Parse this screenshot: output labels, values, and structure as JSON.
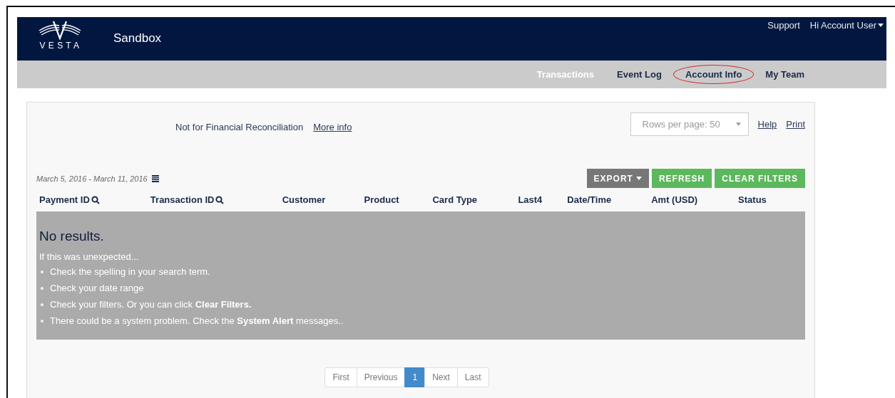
{
  "header": {
    "logo_text": "V E S T A",
    "title": "Sandbox",
    "links": [
      {
        "label": "Support",
        "kind": "link"
      },
      {
        "label": "Hi Account User",
        "kind": "dropdown"
      }
    ]
  },
  "nav": [
    {
      "label": "Transactions",
      "selected": true,
      "highlighted": false
    },
    {
      "label": "Event Log",
      "selected": false,
      "highlighted": false
    },
    {
      "label": "Account Info",
      "selected": false,
      "highlighted": true
    },
    {
      "label": "My Team",
      "selected": false,
      "highlighted": false
    }
  ],
  "notice": {
    "text": "Not for Financial Reconciliation",
    "link": "More info"
  },
  "rows_per_page": {
    "value": "Rows per page: 50"
  },
  "top_links": [
    "Help",
    "Print"
  ],
  "date_range": "March 5, 2016 - March 11, 2016",
  "actions": [
    {
      "label": "EXPORT",
      "kind": "dropdown"
    },
    {
      "label": "REFRESH",
      "kind": "button"
    },
    {
      "label": "CLEAR FILTERS",
      "kind": "button"
    }
  ],
  "table": {
    "columns": [
      {
        "label": "Payment ID",
        "searchable": true
      },
      {
        "label": "Transaction ID",
        "searchable": true
      },
      {
        "label": "Customer",
        "searchable": false
      },
      {
        "label": "Product",
        "searchable": false
      },
      {
        "label": "Card Type",
        "searchable": false
      },
      {
        "label": "Last4",
        "searchable": false
      },
      {
        "label": "Date/Time",
        "searchable": false
      },
      {
        "label": "Amt (USD)",
        "searchable": false
      },
      {
        "label": "Status",
        "searchable": false
      }
    ]
  },
  "empty_state": {
    "title": "No results.",
    "intro": "If this was unexpected...",
    "tips": [
      "Check the spelling in your search term.",
      "Check your date range",
      "Check your filters. Or you can click **Clear Filters.**",
      "There could be a system problem. Check the **System Alert** messages.."
    ]
  },
  "pagination": [
    {
      "label": "First",
      "selected": false
    },
    {
      "label": "Previous",
      "selected": false
    },
    {
      "label": "1",
      "selected": true
    },
    {
      "label": "Next",
      "selected": false
    },
    {
      "label": "Last",
      "selected": false
    }
  ]
}
